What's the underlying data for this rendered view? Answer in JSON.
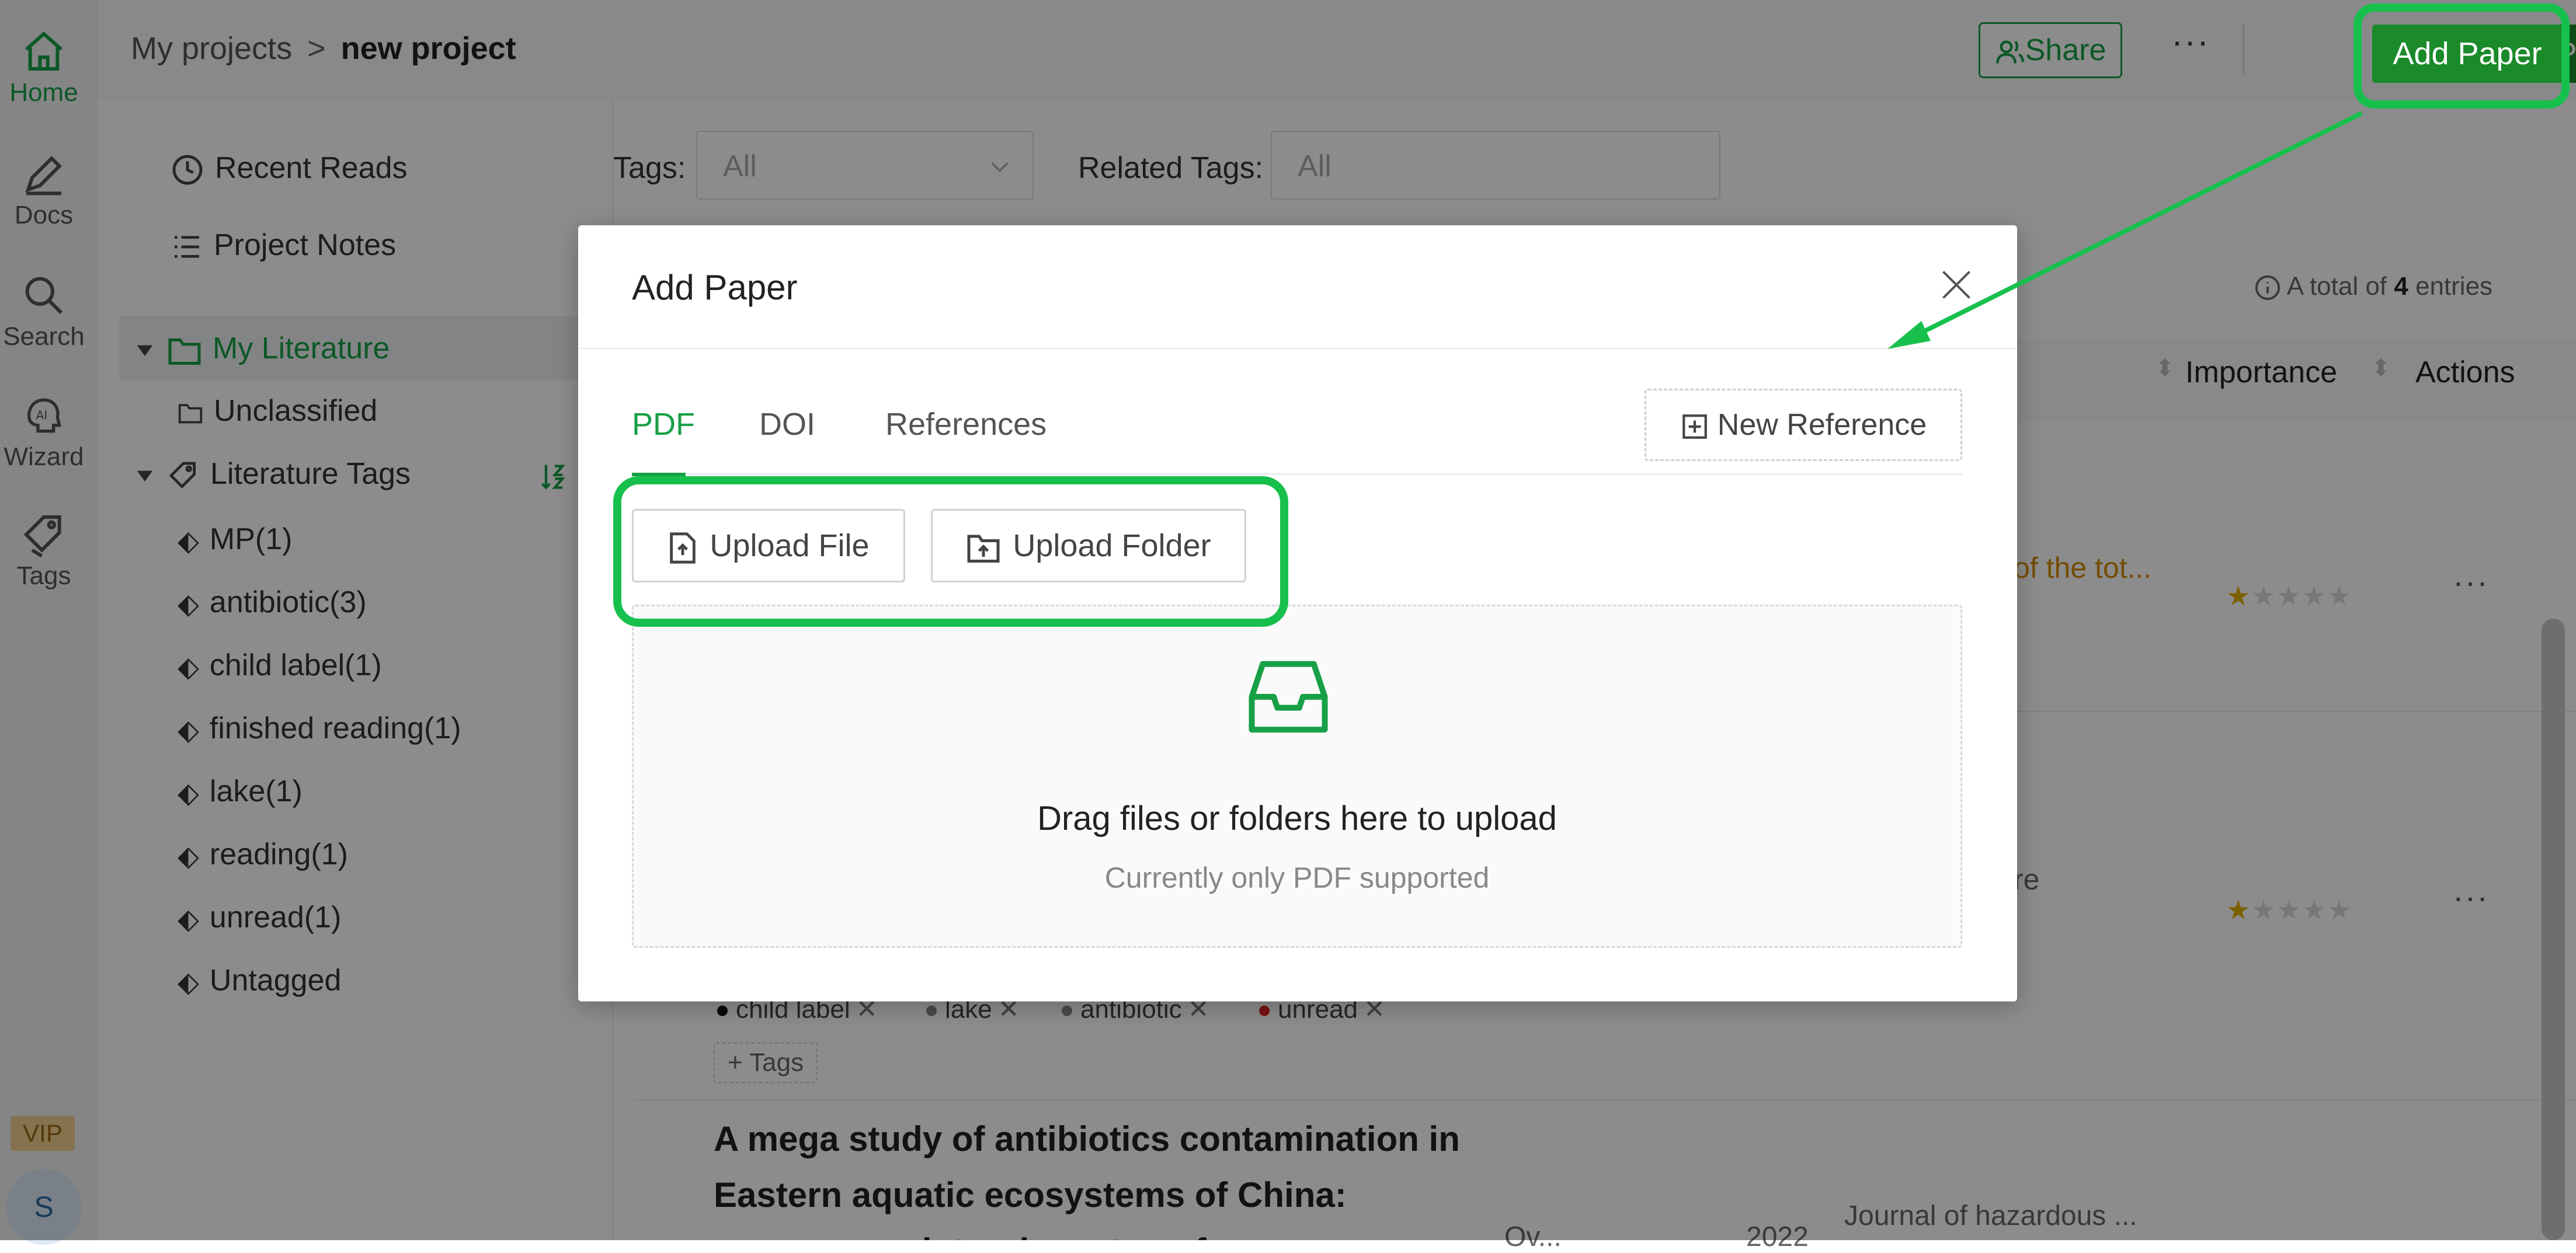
{
  "rail": {
    "items": [
      {
        "label": "Home",
        "icon": "home-icon"
      },
      {
        "label": "Docs",
        "icon": "pencil-icon"
      },
      {
        "label": "Search",
        "icon": "search-icon"
      },
      {
        "label": "Wizard",
        "icon": "ai-icon"
      },
      {
        "label": "Tags",
        "icon": "tag-icon"
      }
    ],
    "vip": "VIP",
    "avatar_initial": "S"
  },
  "topbar": {
    "breadcrumb_root": "My projects",
    "breadcrumb_sep": ">",
    "breadcrumb_current": "new project",
    "share_label": "Share",
    "more_label": "···",
    "add_paper_label": "Add Paper"
  },
  "leftpanel": {
    "recent_reads": "Recent Reads",
    "project_notes": "Project Notes",
    "my_literature": "My Literature",
    "unclassified": "Unclassified",
    "literature_tags": "Literature Tags",
    "tags": [
      {
        "label": "MP(1)",
        "color": "#1fb6c9"
      },
      {
        "label": "antibiotic(3)",
        "color": "#888888"
      },
      {
        "label": "child label(1)",
        "color": "#111111"
      },
      {
        "label": "finished reading(1)",
        "color": "#111111"
      },
      {
        "label": "lake(1)",
        "color": "#888888"
      },
      {
        "label": "reading(1)",
        "color": "#7a1aa0"
      },
      {
        "label": "unread(1)",
        "color": "#e02424"
      }
    ],
    "untagged": "Untagged"
  },
  "main": {
    "tags_label": "Tags:",
    "tags_value": "All",
    "related_label": "Related Tags:",
    "related_value": "All",
    "total_prefix": "A total of",
    "total_count": "4",
    "total_suffix": "entries",
    "col_importance": "Importance",
    "col_actions": "Actions",
    "row1_snippet": "of the tot...",
    "row2_snippet": "re",
    "row_more": "···",
    "chips": [
      {
        "label": "child label",
        "color": "#111111"
      },
      {
        "label": "lake",
        "color": "#888888"
      },
      {
        "label": "antibiotic",
        "color": "#888888"
      },
      {
        "label": "unread",
        "color": "#e02424"
      }
    ],
    "add_tags": "+ Tags",
    "paper3_title": "A mega study of antibiotics contamination in Eastern aquatic ecosystems of China: occurrence, interphase transfer processes",
    "paper3_journal": "Journal of hazardous ...",
    "paper3_year": "2022",
    "paper3_author": "Ov..."
  },
  "modal": {
    "title": "Add Paper",
    "tabs": [
      "PDF",
      "DOI",
      "References"
    ],
    "active_tab": "PDF",
    "new_reference": "New Reference",
    "upload_file": "Upload File",
    "upload_folder": "Upload Folder",
    "drop_main": "Drag files or folders here to upload",
    "drop_sub": "Currently only PDF supported"
  },
  "colors": {
    "accent": "#17a046",
    "highlight": "#17c04c",
    "add_paper_bg": "#1a8a2a"
  }
}
